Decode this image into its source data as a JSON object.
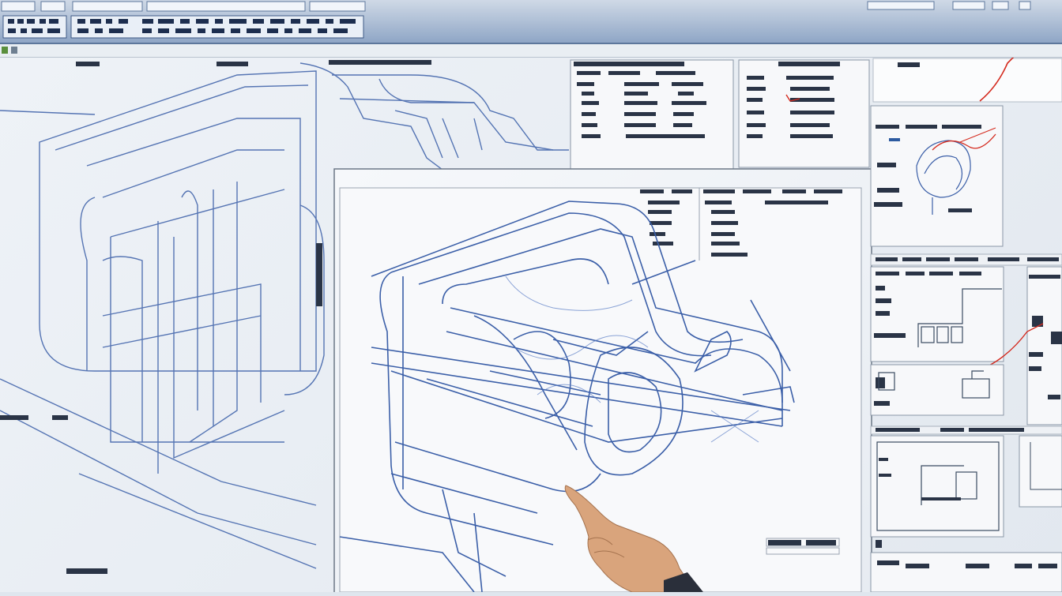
{
  "colors": {
    "toolbar_top": "#cfd9e6",
    "toolbar_bottom": "#8fa6c6",
    "sketch_line": "#3b5fa8",
    "annotation_red": "#d42a1e",
    "panel_bg": "#f7f8fa"
  },
  "icons": [
    "toolbar-button-icon",
    "layer-icon",
    "cursor-hand"
  ]
}
